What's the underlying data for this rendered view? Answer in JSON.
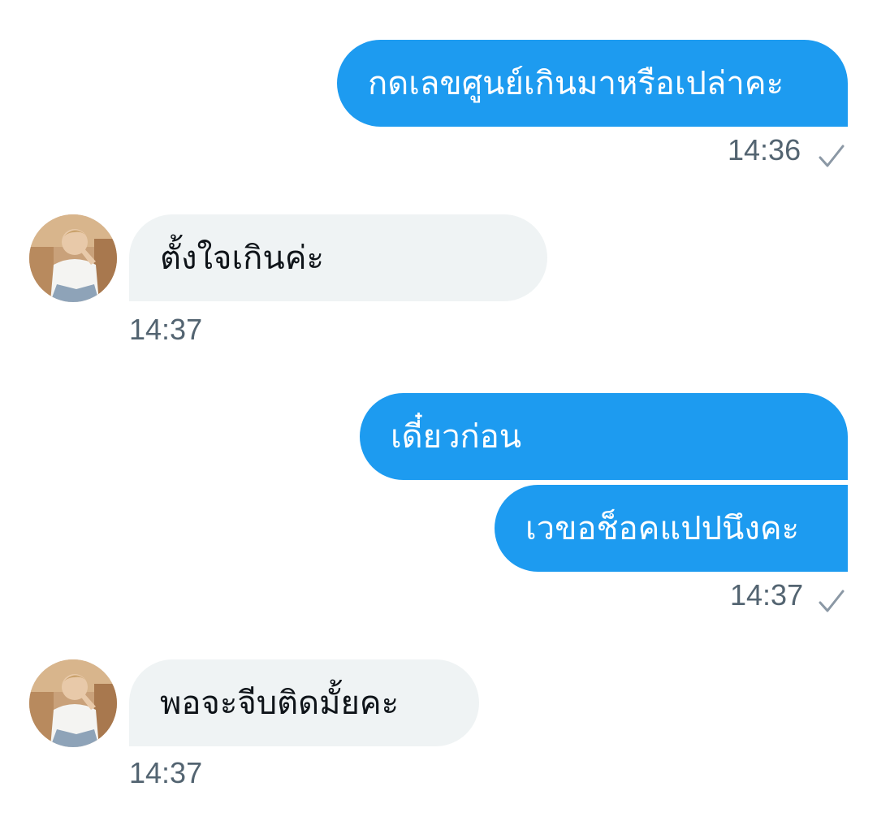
{
  "messages": [
    {
      "direction": "outgoing",
      "text": "กดเลขศูนย์เกินมาหรือเปล่าคะ"
    },
    {
      "direction": "incoming",
      "text": "ตั้งใจเกินค่ะ"
    },
    {
      "direction": "outgoing",
      "text": "เดี๋ยวก่อน"
    },
    {
      "direction": "outgoing",
      "text": "เวขอช็อคแปปนึงคะ"
    },
    {
      "direction": "incoming",
      "text": "พอจะจีบติดมั้ยคะ"
    }
  ],
  "timestamps": [
    "14:36",
    "14:37",
    "14:37",
    "14:37"
  ],
  "icons": {
    "read_receipt": "checkmark-icon",
    "avatar": "user-avatar"
  },
  "colors": {
    "outgoing_bubble": "#1d9bf0",
    "incoming_bubble": "#eff3f4",
    "timestamp": "#536471",
    "checkmark": "#8b98a5"
  }
}
